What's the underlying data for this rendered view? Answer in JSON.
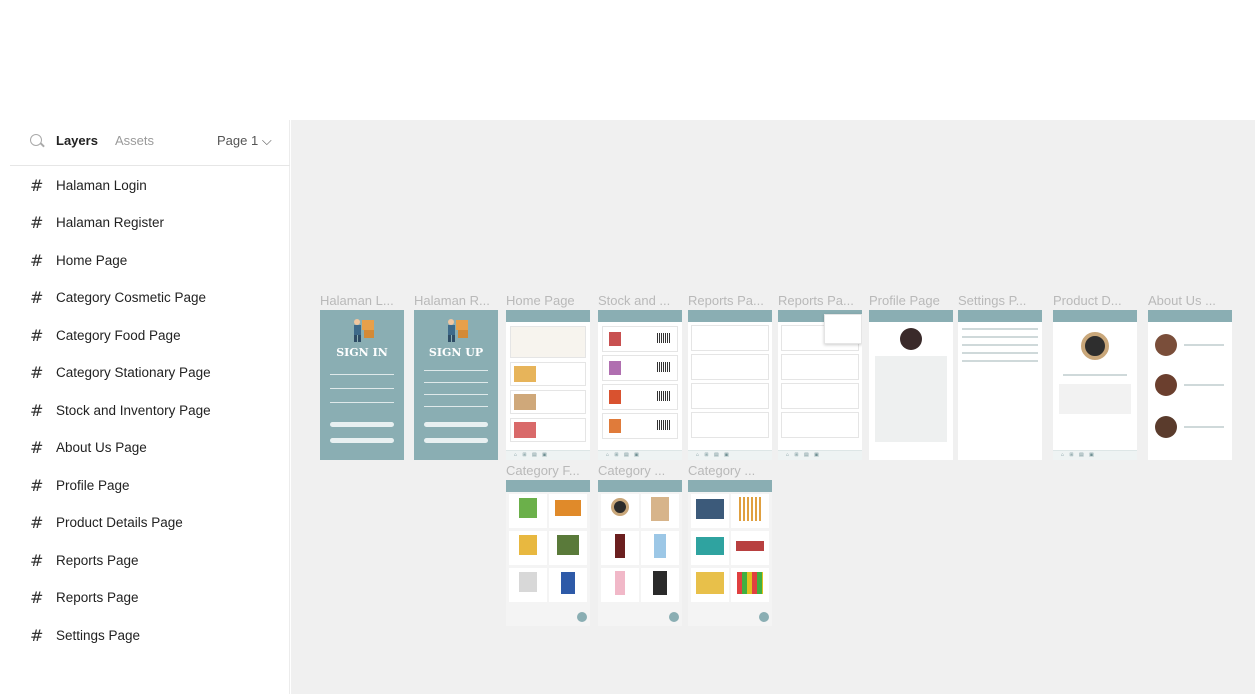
{
  "panel": {
    "tabs": {
      "layers": "Layers",
      "assets": "Assets"
    },
    "page_select": "Page 1 ⌵",
    "layers": [
      "Halaman Login",
      "Halaman Register",
      "Home Page",
      "Category Cosmetic Page",
      "Category Food Page",
      "Category Stationary Page",
      "Stock and Inventory Page",
      "About Us Page",
      "Profile Page",
      "Product Details Page",
      "Reports Page",
      "Reports Page",
      "Settings Page"
    ]
  },
  "canvas": {
    "frame_labels_row1": [
      "Halaman L...",
      "Halaman R...",
      "Home Page",
      "Stock and ...",
      "Reports Pa...",
      "Reports Pa...",
      "Profile Page",
      "Settings P...",
      "Product D...",
      "About Us ..."
    ],
    "frame_labels_row2": [
      "Category F...",
      "Category ...",
      "Category ..."
    ],
    "signin": "SIGN IN",
    "signup": "SIGN UP"
  },
  "colors": {
    "accent": "#8aaeb3",
    "canvas": "#f0f0f0"
  }
}
